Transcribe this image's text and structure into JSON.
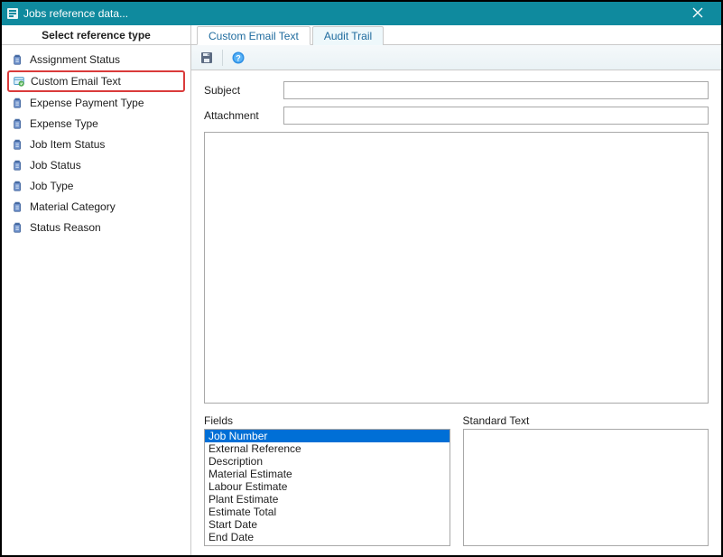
{
  "window": {
    "title": "Jobs reference data..."
  },
  "sidebar": {
    "header": "Select reference type",
    "items": [
      {
        "label": "Assignment Status",
        "selected": false
      },
      {
        "label": "Custom Email Text",
        "selected": true
      },
      {
        "label": "Expense Payment Type",
        "selected": false
      },
      {
        "label": "Expense Type",
        "selected": false
      },
      {
        "label": "Job Item Status",
        "selected": false
      },
      {
        "label": "Job Status",
        "selected": false
      },
      {
        "label": "Job Type",
        "selected": false
      },
      {
        "label": "Material Category",
        "selected": false
      },
      {
        "label": "Status Reason",
        "selected": false
      }
    ]
  },
  "tabs": {
    "items": [
      {
        "label": "Custom Email Text",
        "active": true
      },
      {
        "label": "Audit Trail",
        "active": false
      }
    ]
  },
  "form": {
    "subjectLabel": "Subject",
    "subjectValue": "",
    "attachmentLabel": "Attachment",
    "attachmentValue": "",
    "bodyValue": ""
  },
  "fields": {
    "label": "Fields",
    "options": [
      {
        "label": "Job Number",
        "selected": true
      },
      {
        "label": "External Reference",
        "selected": false
      },
      {
        "label": "Description",
        "selected": false
      },
      {
        "label": "Material Estimate",
        "selected": false
      },
      {
        "label": "Labour Estimate",
        "selected": false
      },
      {
        "label": "Plant Estimate",
        "selected": false
      },
      {
        "label": "Estimate Total",
        "selected": false
      },
      {
        "label": "Start Date",
        "selected": false
      },
      {
        "label": "End Date",
        "selected": false
      }
    ]
  },
  "standardText": {
    "label": "Standard Text",
    "value": ""
  }
}
